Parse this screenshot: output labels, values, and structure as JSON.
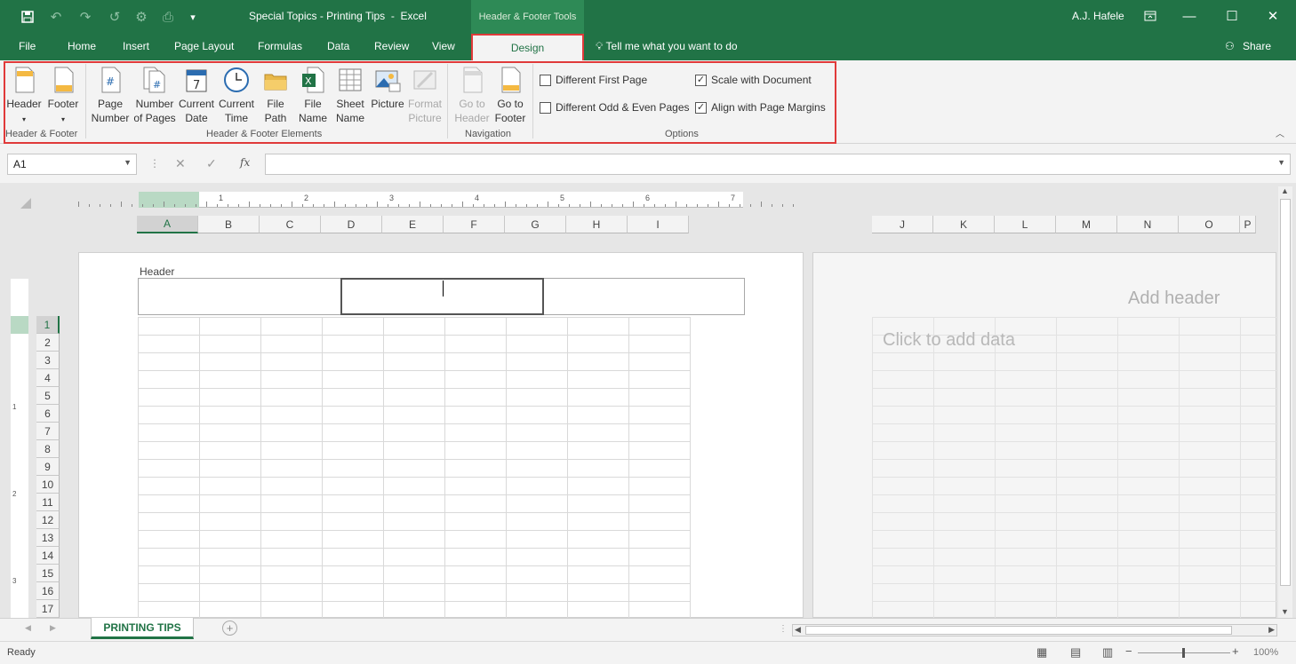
{
  "window": {
    "title": "Special Topics - Printing Tips  -  Excel",
    "context_tool": "Header & Footer Tools",
    "user": "A.J. Hafele"
  },
  "menu": {
    "tabs": [
      "File",
      "Home",
      "Insert",
      "Page Layout",
      "Formulas",
      "Data",
      "Review",
      "View"
    ],
    "active_tab": "Design",
    "tell_me": "Tell me what you want to do",
    "share": "Share"
  },
  "ribbon": {
    "header_footer": {
      "header": "Header",
      "footer": "Footer",
      "label": "Header & Footer"
    },
    "elements": {
      "page_number": [
        "Page",
        "Number"
      ],
      "number_of_pages": [
        "Number",
        "of Pages"
      ],
      "current_date": [
        "Current",
        "Date"
      ],
      "current_time": [
        "Current",
        "Time"
      ],
      "file_path": [
        "File",
        "Path"
      ],
      "file_name": [
        "File",
        "Name"
      ],
      "sheet_name": [
        "Sheet",
        "Name"
      ],
      "picture": "Picture",
      "format_picture": [
        "Format",
        "Picture"
      ],
      "label": "Header & Footer Elements"
    },
    "navigation": {
      "go_to_header": [
        "Go to",
        "Header"
      ],
      "go_to_footer": [
        "Go to",
        "Footer"
      ],
      "label": "Navigation"
    },
    "options": {
      "different_first_page": "Different First Page",
      "different_odd_even": "Different Odd & Even Pages",
      "scale_with_document": "Scale with Document",
      "align_with_margins": "Align with Page Margins",
      "checked": {
        "different_first_page": false,
        "different_odd_even": false,
        "scale_with_document": true,
        "align_with_margins": true
      },
      "label": "Options"
    }
  },
  "formula_bar": {
    "name_box": "A1",
    "fx": "fx",
    "value": ""
  },
  "sheet": {
    "columns_left": [
      "A",
      "B",
      "C",
      "D",
      "E",
      "F",
      "G",
      "H",
      "I"
    ],
    "columns_right": [
      "J",
      "K",
      "L",
      "M",
      "N",
      "O",
      "P"
    ],
    "rows": [
      "1",
      "2",
      "3",
      "4",
      "5",
      "6",
      "7",
      "8",
      "9",
      "10",
      "11",
      "12",
      "13",
      "14",
      "15",
      "16",
      "17"
    ],
    "ruler_numbers": [
      "1",
      "2",
      "3",
      "4",
      "5",
      "6",
      "7"
    ],
    "vruler_numbers": [
      "1",
      "2",
      "3"
    ],
    "header_label": "Header",
    "add_header": "Add header",
    "click_to_add": "Click to add data",
    "tab": "PRINTING TIPS"
  },
  "status": {
    "ready": "Ready",
    "zoom": "100%"
  }
}
